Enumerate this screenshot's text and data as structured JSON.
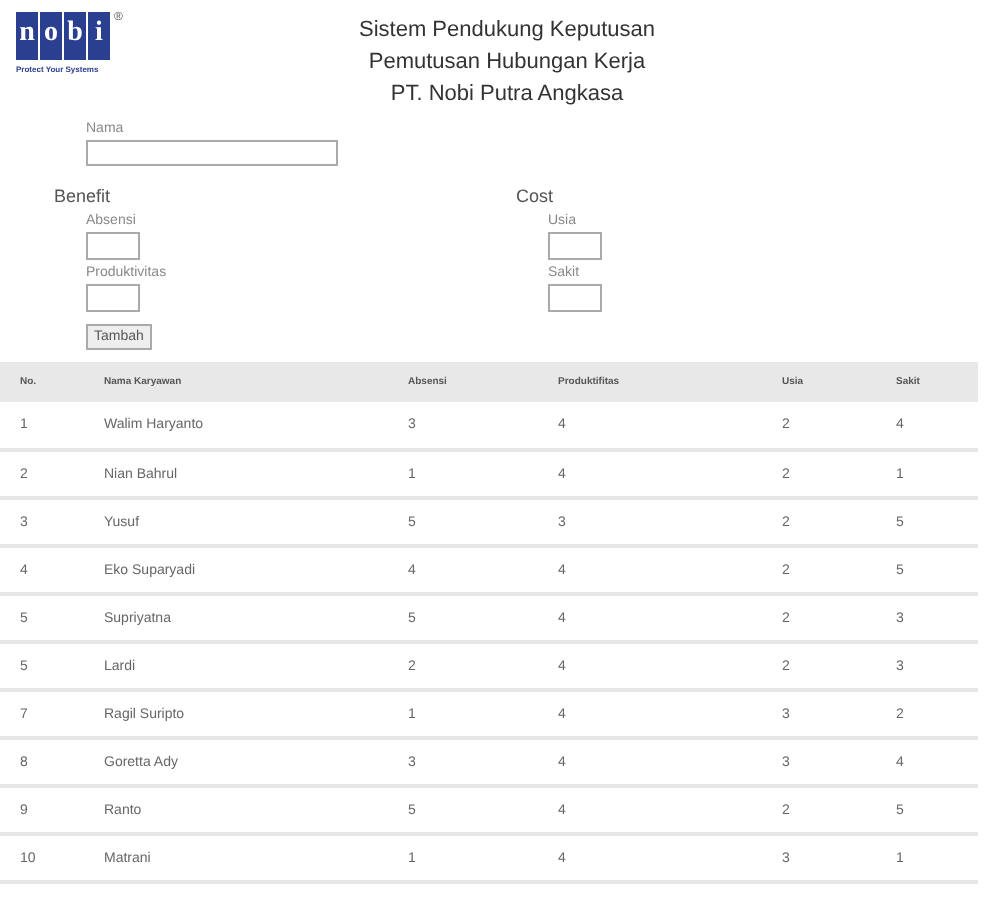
{
  "logo": {
    "letters": [
      "n",
      "o",
      "b",
      "i"
    ],
    "mark": "®",
    "tagline": "Protect Your Systems"
  },
  "header": {
    "lines": [
      "Sistem Pendukung Keputusan",
      "Pemutusan Hubungan Kerja",
      "PT. Nobi Putra Angkasa"
    ]
  },
  "form": {
    "name_label": "Nama",
    "groups": [
      {
        "title": "Benefit",
        "fields": [
          "Absensi",
          "Produktivitas"
        ]
      },
      {
        "title": "Cost",
        "fields": [
          "Usia",
          "Sakit"
        ]
      }
    ],
    "button": "Tambah"
  },
  "table": {
    "columns": [
      "No.",
      "Nama Karyawan",
      "Absensi",
      "Produktifitas",
      "Usia",
      "Sakit"
    ],
    "rows": [
      [
        "1",
        "Walim Haryanto",
        "3",
        "4",
        "2",
        "4"
      ],
      [
        "2",
        "Nian Bahrul",
        "1",
        "4",
        "2",
        "1"
      ],
      [
        "3",
        "Yusuf",
        "5",
        "3",
        "2",
        "5"
      ],
      [
        "4",
        "Eko Suparyadi",
        "4",
        "4",
        "2",
        "5"
      ],
      [
        "5",
        "Supriyatna",
        "5",
        "4",
        "2",
        "3"
      ],
      [
        "5",
        "Lardi",
        "2",
        "4",
        "2",
        "3"
      ],
      [
        "7",
        "Ragil Suripto",
        "1",
        "4",
        "3",
        "2"
      ],
      [
        "8",
        "Goretta Ady",
        "3",
        "4",
        "3",
        "4"
      ],
      [
        "9",
        "Ranto",
        "5",
        "4",
        "2",
        "5"
      ],
      [
        "10",
        "Matrani",
        "1",
        "4",
        "3",
        "1"
      ]
    ]
  }
}
